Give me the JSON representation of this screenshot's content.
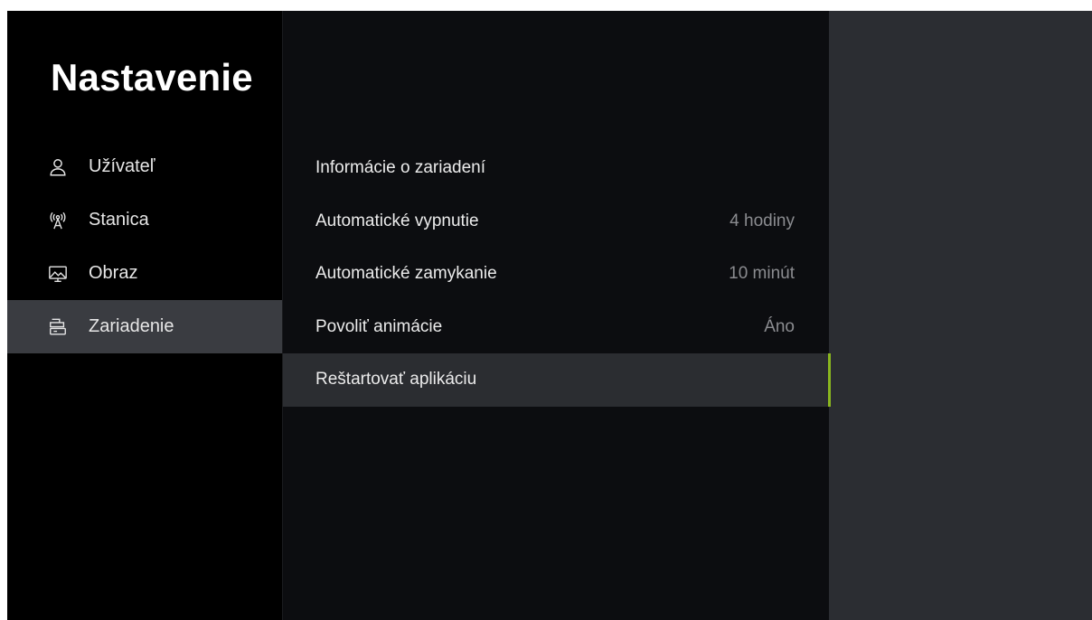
{
  "colors": {
    "sidebar_bg": "#000000",
    "main_bg": "#0c0d10",
    "right_panel_bg": "#2b2d32",
    "selected_bg": "#3a3c41",
    "focused_bg": "#2b2d31",
    "accent": "#8ab61f",
    "value_text": "#8b8c90"
  },
  "sidebar": {
    "title": "Nastavenie",
    "items": [
      {
        "label": "Užívateľ",
        "icon": "user-icon"
      },
      {
        "label": "Stanica",
        "icon": "antenna-icon"
      },
      {
        "label": "Obraz",
        "icon": "display-icon"
      },
      {
        "label": "Zariadenie",
        "icon": "device-icon",
        "selected": true
      }
    ]
  },
  "main": {
    "items": [
      {
        "label": "Informácie o zariadení",
        "value": ""
      },
      {
        "label": "Automatické vypnutie",
        "value": "4 hodiny"
      },
      {
        "label": "Automatické zamykanie",
        "value": "10 minút"
      },
      {
        "label": "Povoliť animácie",
        "value": "Áno"
      },
      {
        "label": "Reštartovať aplikáciu",
        "value": "",
        "focused": true
      }
    ]
  }
}
